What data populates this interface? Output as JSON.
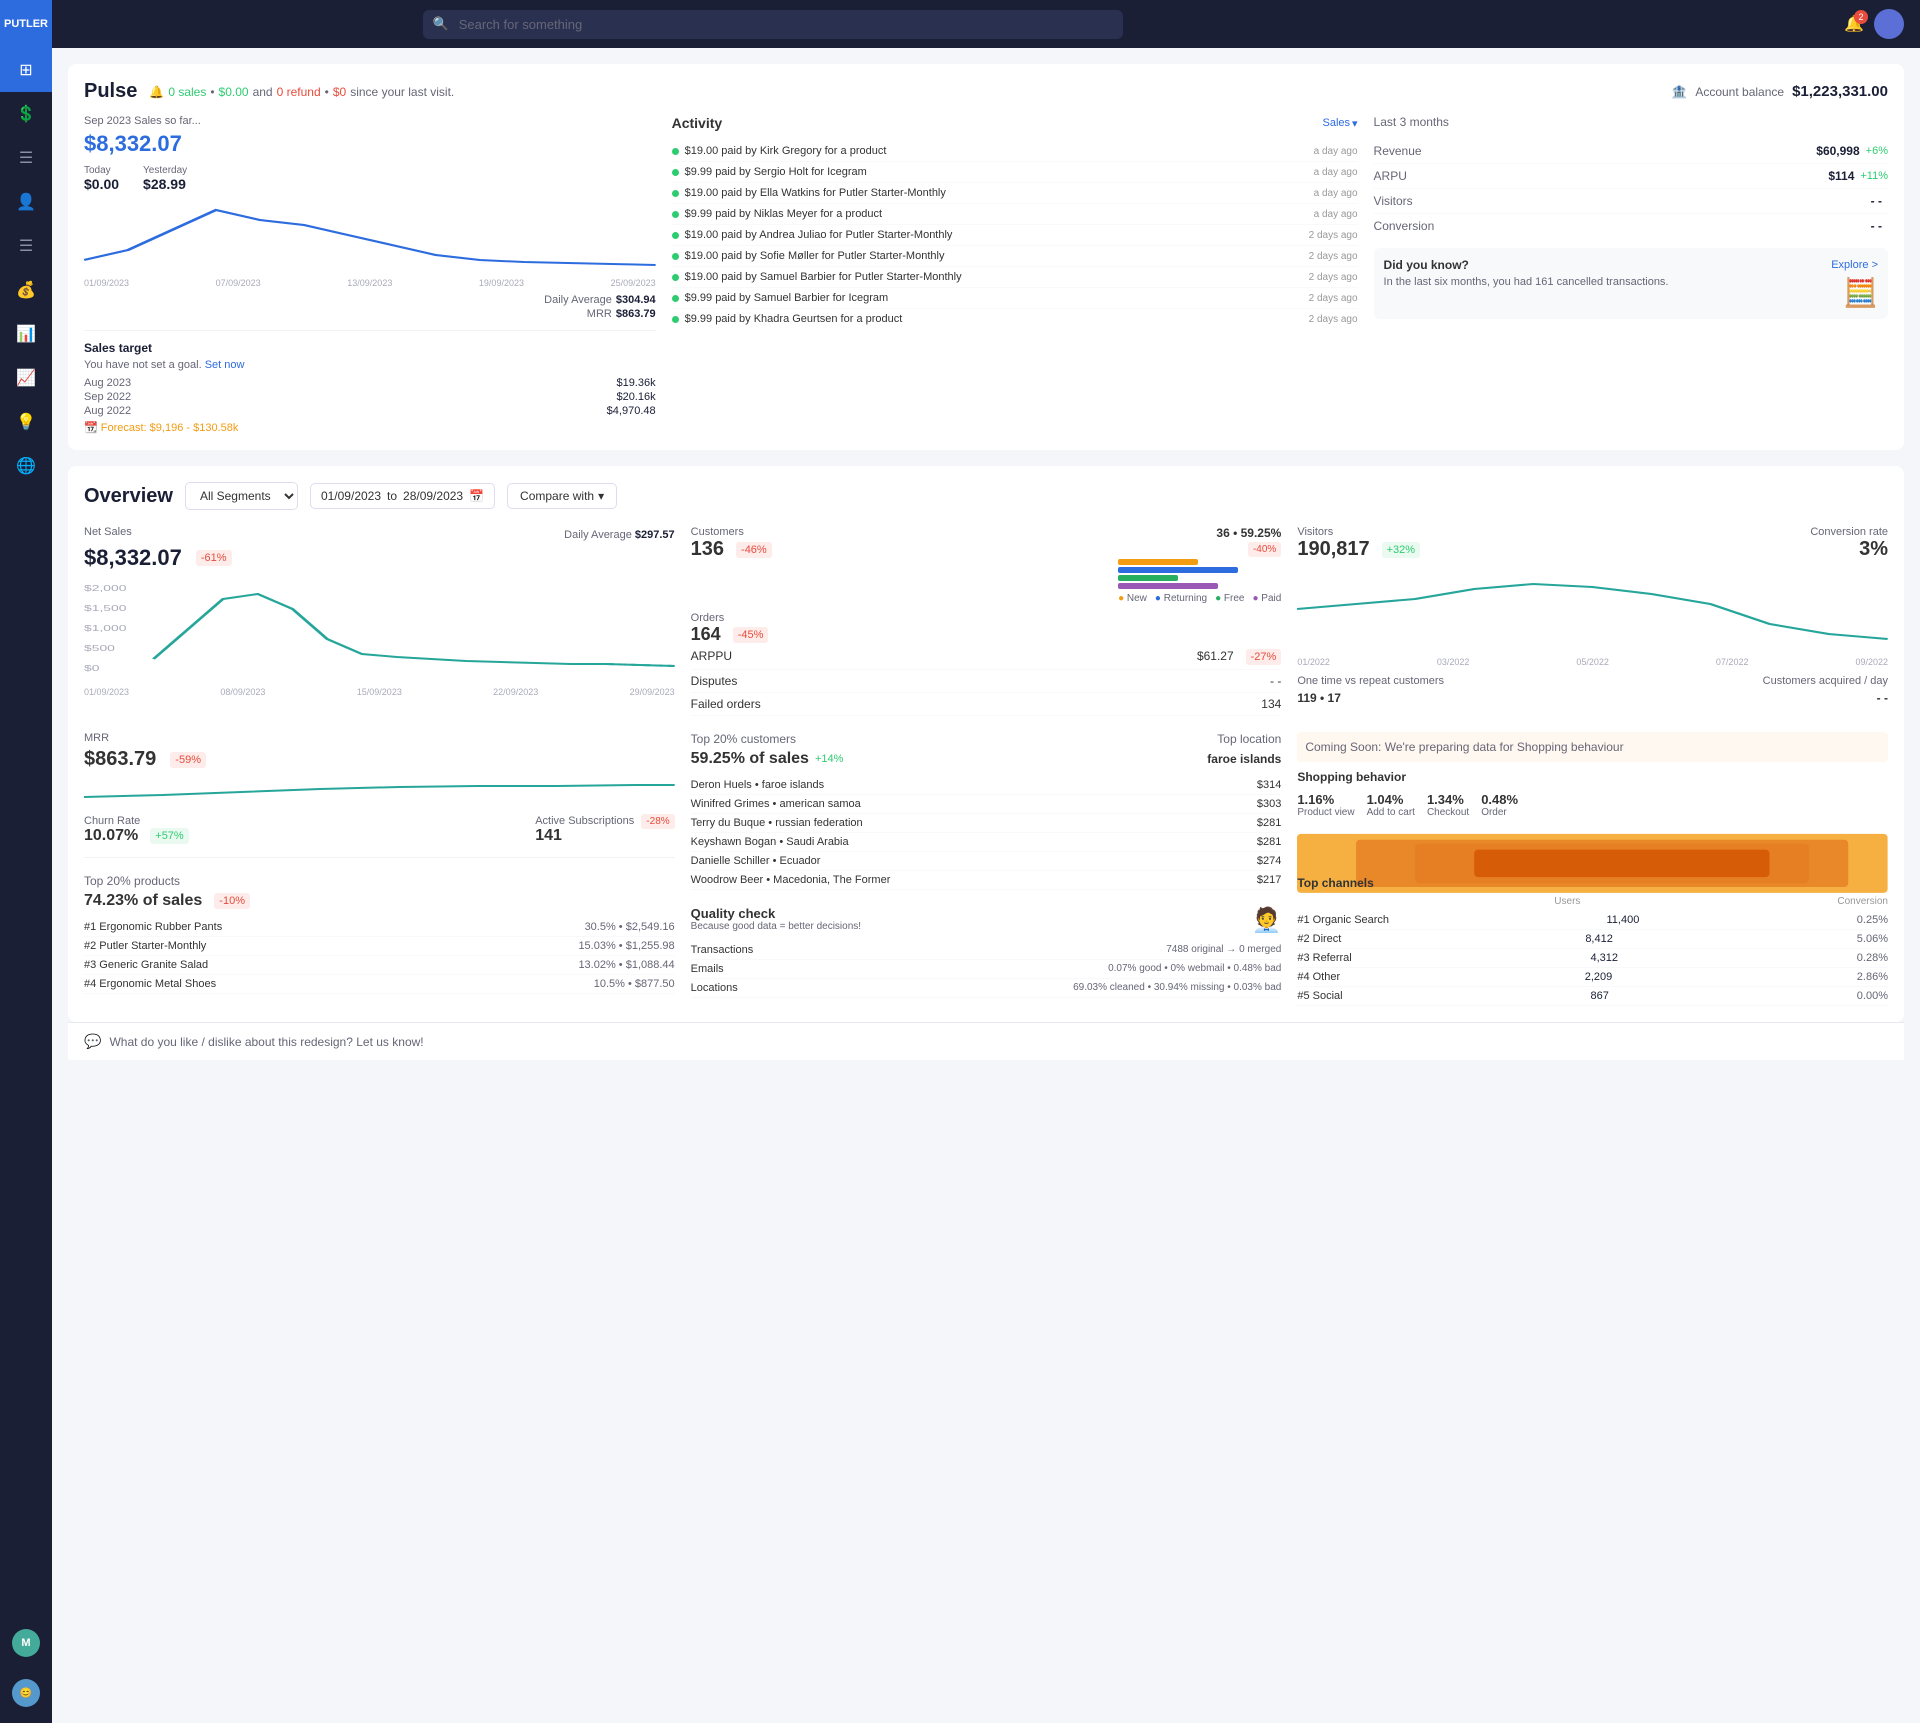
{
  "app": {
    "name": "PUTLER"
  },
  "topbar": {
    "search_placeholder": "Search for something",
    "notif_count": "2"
  },
  "sidebar": {
    "items": [
      {
        "id": "dashboard",
        "icon": "⊞",
        "label": "Dashboard",
        "active": true
      },
      {
        "id": "sales",
        "icon": "💲",
        "label": "Sales"
      },
      {
        "id": "orders",
        "icon": "📋",
        "label": "Orders"
      },
      {
        "id": "customers",
        "icon": "👤",
        "label": "Customers"
      },
      {
        "id": "reports",
        "icon": "📊",
        "label": "Reports"
      },
      {
        "id": "subscriptions",
        "icon": "💰",
        "label": "Subscriptions"
      },
      {
        "id": "analytics",
        "icon": "📈",
        "label": "Analytics"
      },
      {
        "id": "trends",
        "icon": "📉",
        "label": "Trends"
      },
      {
        "id": "insights",
        "icon": "💡",
        "label": "Insights"
      },
      {
        "id": "global",
        "icon": "🌐",
        "label": "Global"
      }
    ],
    "user1": {
      "initials": "M",
      "color": "#4a9"
    },
    "user2": {
      "initials": "😊",
      "color": "#59c"
    }
  },
  "pulse": {
    "title": "Pulse",
    "since_label": "since your last visit.",
    "sales_count": "0 sales",
    "sales_amount": "$0.00",
    "refund_count": "0 refund",
    "refund_amount": "$0",
    "and_label": "and",
    "account_balance_label": "Account balance",
    "account_balance_value": "$1,223,331.00",
    "sales_card": {
      "period": "Sep 2023 Sales so far...",
      "amount": "$8,332.07",
      "today_label": "Today",
      "today_value": "$0.00",
      "yesterday_label": "Yesterday",
      "yesterday_value": "$28.99",
      "daily_avg_label": "Daily Average",
      "daily_avg_value": "$304.94",
      "mrr_label": "MRR",
      "mrr_value": "$863.79"
    },
    "sales_target": {
      "title": "Sales target",
      "subtitle": "You have not set a goal.",
      "set_now": "Set now",
      "rows": [
        {
          "date": "Aug 2023",
          "amount": "$19.36k"
        },
        {
          "date": "Sep 2022",
          "amount": "$20.16k"
        },
        {
          "date": "Aug 2022",
          "amount": "$4,970.48"
        }
      ],
      "forecast": "Forecast: $9,196 - $130.58k"
    },
    "activity": {
      "title": "Activity",
      "filter": "Sales",
      "items": [
        {
          "text": "$19.00 paid by Kirk Gregory for a product",
          "time": "a day ago"
        },
        {
          "text": "$9.99 paid by Sergio Holt for Icegram",
          "time": "a day ago"
        },
        {
          "text": "$19.00 paid by Ella Watkins for Putler Starter-Monthly",
          "time": "a day ago"
        },
        {
          "text": "$9.99 paid by Niklas Meyer for a product",
          "time": "a day ago"
        },
        {
          "text": "$19.00 paid by Andrea Juliao for Putler Starter-Monthly",
          "time": "2 days ago"
        },
        {
          "text": "$19.00 paid by Sofie Møller for Putler Starter-Monthly",
          "time": "2 days ago"
        },
        {
          "text": "$19.00 paid by Samuel Barbier for Putler Starter-Monthly",
          "time": "2 days ago"
        },
        {
          "text": "$9.99 paid by Samuel Barbier for Icegram",
          "time": "2 days ago"
        },
        {
          "text": "$9.99 paid by Khadra Geurtsen for a product",
          "time": "2 days ago"
        }
      ]
    },
    "last3": {
      "title": "Last 3 months",
      "rows": [
        {
          "label": "Revenue",
          "value": "$60,998",
          "change": "+6%",
          "pos": true
        },
        {
          "label": "ARPU",
          "value": "$114",
          "change": "+11%",
          "pos": true
        },
        {
          "label": "Visitors",
          "value": "- -",
          "change": "",
          "pos": null
        },
        {
          "label": "Conversion",
          "value": "- -",
          "change": "",
          "pos": null
        }
      ]
    },
    "did_you_know": {
      "title": "Did you know?",
      "explore": "Explore >",
      "text": "In the last six months, you had 161 cancelled transactions."
    }
  },
  "overview": {
    "title": "Overview",
    "segment_options": [
      "All Segments"
    ],
    "segment_selected": "All Segments",
    "date_from": "01/09/2023",
    "date_to": "28/09/2023",
    "compare_label": "Compare with",
    "net_sales": {
      "label": "Net Sales",
      "value": "$8,332.07",
      "badge": "-61%",
      "daily_avg_label": "Daily Average",
      "daily_avg_value": "$297.57",
      "chart_labels": [
        "01/09/2023",
        "08/09/2023",
        "15/09/2023",
        "22/09/2023",
        "29/09/2023"
      ]
    },
    "customers": {
      "label": "Customers",
      "value": "136",
      "badge": "-46%",
      "donut_label": "36 • 59.25%",
      "donut_badge": "-40%",
      "orders_label": "Orders",
      "orders_value": "164",
      "orders_badge": "-45%",
      "arppu_label": "ARPPU",
      "arppu_value": "$61.27",
      "arppu_badge": "-27%",
      "disputes_label": "Disputes",
      "disputes_value": "- -",
      "failed_label": "Failed orders",
      "failed_value": "134",
      "legend": [
        {
          "label": "New",
          "color": "#f39c12"
        },
        {
          "label": "Returning",
          "color": "#2d6cdf"
        },
        {
          "label": "Free",
          "color": "#27ae60"
        },
        {
          "label": "Paid",
          "color": "#9b59b6"
        }
      ]
    },
    "visitors": {
      "label": "Visitors",
      "value": "190,817",
      "badge": "+32%",
      "conv_label": "Conversion rate",
      "conv_value": "3%",
      "one_time_label": "One time vs repeat customers",
      "one_time_value": "119 • 17",
      "acq_label": "Customers acquired / day",
      "acq_value": "- -",
      "chart_labels": [
        "01/2022",
        "03/2022",
        "05/2022",
        "07/2022",
        "09/2022"
      ]
    },
    "mrr": {
      "label": "MRR",
      "value": "$863.79",
      "badge": "-59%",
      "churn_label": "Churn Rate",
      "churn_value": "10.07%",
      "churn_badge": "+57%",
      "active_sub_label": "Active Subscriptions",
      "active_sub_badge": "-28%",
      "active_sub_value": "141"
    },
    "top_products": {
      "title": "Top 20% products",
      "pct_label": "74.23% of sales",
      "pct_badge": "-10%",
      "items": [
        {
          "rank": "#1",
          "name": "Ergonomic Rubber Pants",
          "pct": "30.5%",
          "value": "$2,549.16"
        },
        {
          "rank": "#2",
          "name": "Putler Starter-Monthly",
          "pct": "15.03%",
          "value": "$1,255.98"
        },
        {
          "rank": "#3",
          "name": "Generic Granite Salad",
          "pct": "13.02%",
          "value": "$1,088.44"
        },
        {
          "rank": "#4",
          "name": "Ergonomic Metal Shoes",
          "pct": "10.5%",
          "value": "$877.50"
        }
      ]
    },
    "top_customers": {
      "title": "Top 20% customers",
      "pct_label": "59.25% of sales",
      "pct_badge": "+14%",
      "location_label": "Top location",
      "location_value": "faroe islands",
      "items": [
        {
          "name": "Deron Huels",
          "location": "faroe islands",
          "value": "$314"
        },
        {
          "name": "Winifred Grimes",
          "location": "american samoa",
          "value": "$303"
        },
        {
          "name": "Terry du Buque",
          "location": "russian federation",
          "value": "$281"
        },
        {
          "name": "Keyshawn Bogan",
          "location": "Saudi Arabia",
          "value": "$281"
        },
        {
          "name": "Danielle Schiller",
          "location": "Ecuador",
          "value": "$274"
        },
        {
          "name": "Woodrow Beer",
          "location": "Macedonia, The Former",
          "value": "$217"
        }
      ]
    },
    "quality_check": {
      "title": "Quality check",
      "subtitle": "Because good data = better decisions!",
      "rows": [
        {
          "label": "Transactions",
          "value": "7488 original → 0 merged"
        },
        {
          "label": "Emails",
          "value": "0.07% good • 0% webmail • 0.48% bad"
        },
        {
          "label": "Locations",
          "value": "69.03% cleaned • 30.94% missing • 0.03% bad"
        }
      ]
    },
    "shopping_behavior": {
      "coming_soon_text": "Coming Soon: We're preparing data for Shopping behaviour",
      "title": "Shopping behavior",
      "funnel": [
        {
          "label": "Product view",
          "pct": "1.16%"
        },
        {
          "label": "Add to cart",
          "pct": "1.04%"
        },
        {
          "label": "Checkout",
          "pct": "1.34%"
        },
        {
          "label": "Order",
          "pct": "0.48%"
        }
      ]
    },
    "top_channels": {
      "title": "Top channels",
      "col_users": "Users",
      "col_conv": "Conversion",
      "items": [
        {
          "rank": "#1",
          "name": "Organic Search",
          "users": "11,400",
          "conv": "0.25%"
        },
        {
          "rank": "#2",
          "name": "Direct",
          "users": "8,412",
          "conv": "5.06%"
        },
        {
          "rank": "#3",
          "name": "Referral",
          "users": "4,312",
          "conv": "0.28%"
        },
        {
          "rank": "#4",
          "name": "Other",
          "users": "2,209",
          "conv": "2.86%"
        },
        {
          "rank": "#5",
          "name": "Social",
          "users": "867",
          "conv": "0.00%"
        }
      ]
    }
  },
  "feedback": {
    "text": "What do you like / dislike about this redesign? Let us know!"
  }
}
